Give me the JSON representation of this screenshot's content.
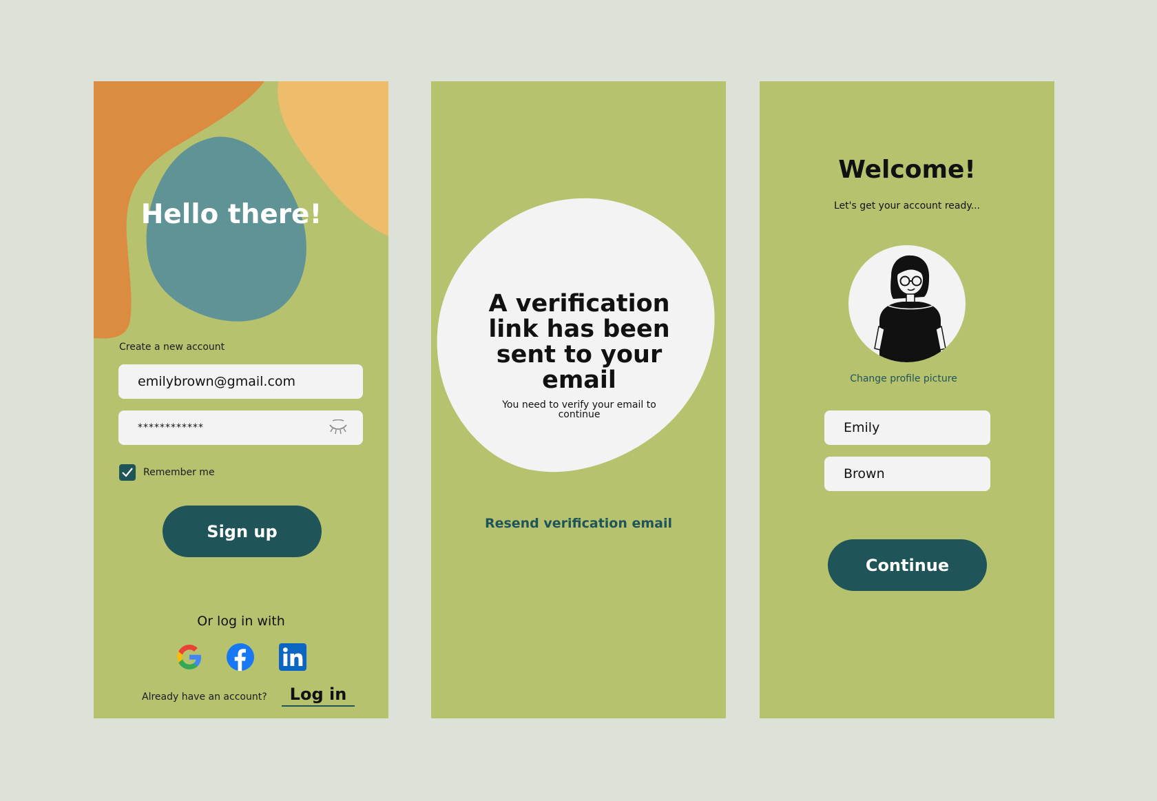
{
  "signup_screen": {
    "greeting": "Hello there!",
    "create_label": "Create a new account",
    "email_value": "emilybrown@gmail.com",
    "password_value": "************",
    "remember_label": "Remember me",
    "remember_checked": true,
    "signup_label": "Sign up",
    "or_login_label": "Or log in with",
    "social": [
      "google-icon",
      "facebook-icon",
      "linkedin-icon"
    ],
    "already_label": "Already have an account?",
    "login_label": "Log in"
  },
  "verify_screen": {
    "title": "A verification link has been sent to your email",
    "subtitle": "You need to verify your email to continue",
    "resend_label": "Resend verification email"
  },
  "profile_screen": {
    "title": "Welcome!",
    "subtitle": "Let's get your account ready...",
    "change_picture_label": "Change profile picture",
    "first_name": "Emily",
    "last_name": "Brown",
    "continue_label": "Continue"
  },
  "colors": {
    "page_background": "#dce2d8",
    "screen_background": "#b7c26e",
    "primary": "#1f5459",
    "blob_orange": "#dc8c40",
    "blob_yellow": "#eebd6b",
    "blob_teal": "#5f9396",
    "field_background": "#f3f3f3"
  }
}
